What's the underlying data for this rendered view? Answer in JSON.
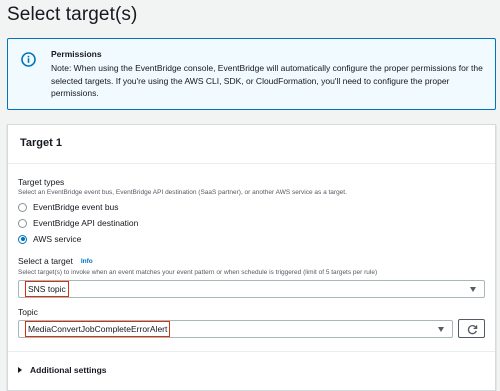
{
  "page": {
    "title": "Select target(s)"
  },
  "permissions": {
    "title": "Permissions",
    "text": "Note: When using the EventBridge console, EventBridge will automatically configure the proper permissions for the selected targets. If you're using the AWS CLI, SDK, or CloudFormation, you'll need to configure the proper permissions."
  },
  "target": {
    "title": "Target 1",
    "types_label": "Target types",
    "types_description": "Select an EventBridge event bus, EventBridge API destination (SaaS partner), or another AWS service as a target.",
    "types": [
      {
        "label": "EventBridge event bus",
        "selected": false
      },
      {
        "label": "EventBridge API destination",
        "selected": false
      },
      {
        "label": "AWS service",
        "selected": true
      }
    ],
    "select_label": "Select a target",
    "select_info": "Info",
    "select_description": "Select target(s) to invoke when an event matches your event pattern or when schedule is triggered (limit of 5 targets per rule)",
    "select_value": "SNS topic",
    "topic_label": "Topic",
    "topic_value": "MediaConvertJobCompleteErrorAlert",
    "additional_settings": "Additional settings"
  },
  "colors": {
    "accent": "#0073bb",
    "highlight": "#d13212",
    "info_bg": "#f1faff"
  },
  "icons": {
    "info": "info-circle-icon",
    "caret": "caret-down-icon",
    "refresh": "refresh-icon",
    "expand": "caret-right-icon"
  }
}
